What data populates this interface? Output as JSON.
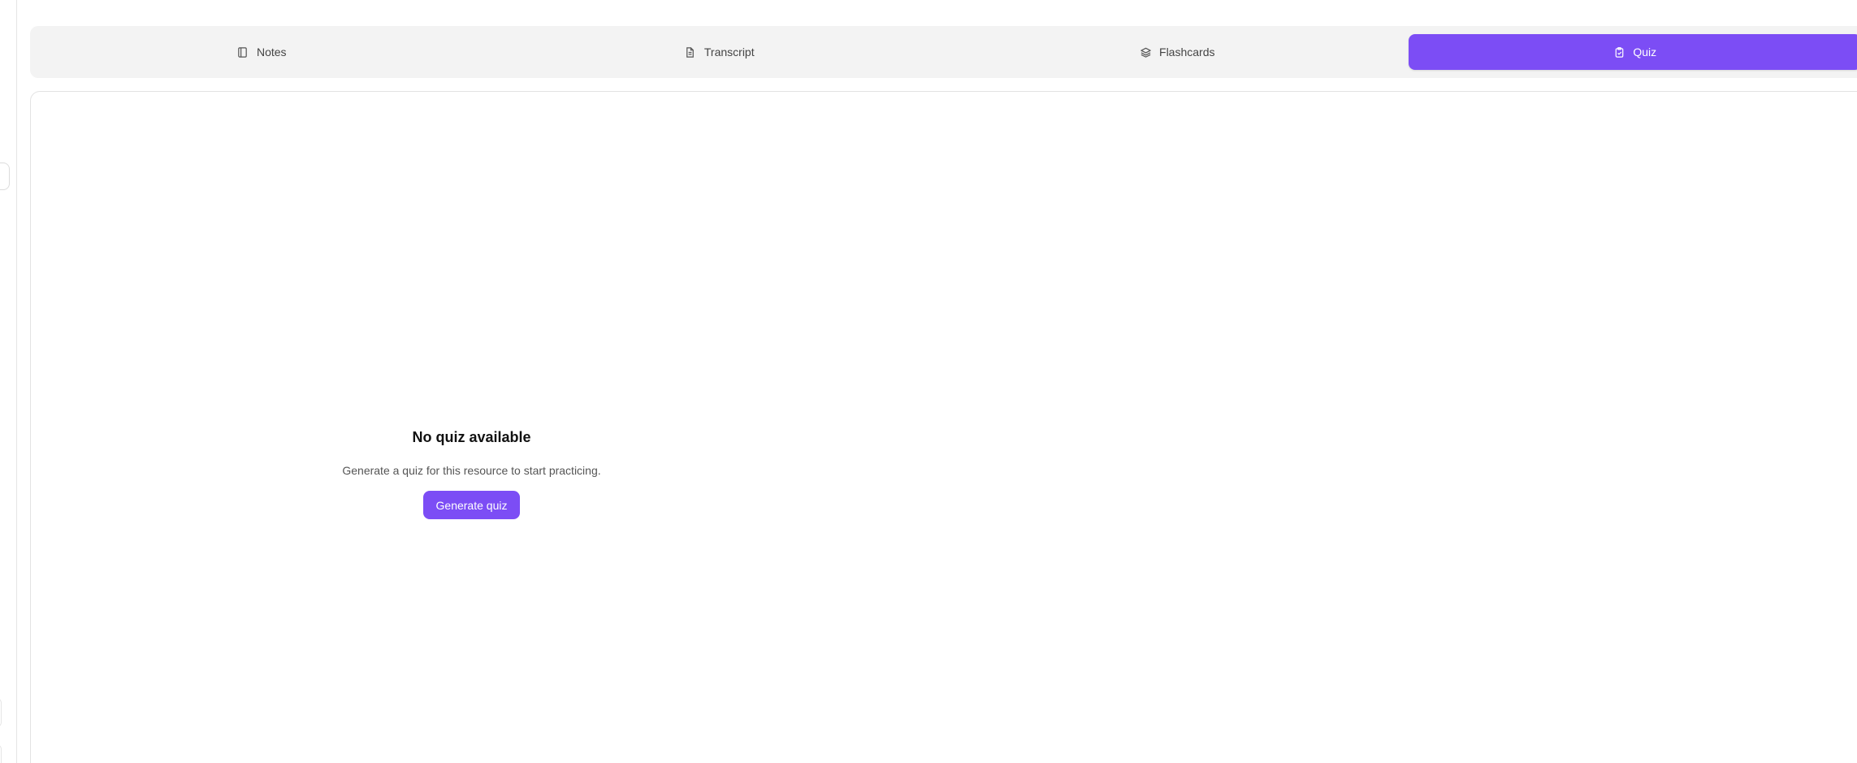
{
  "tabs": [
    {
      "label": "Notes",
      "icon": "notebook-icon",
      "active": false
    },
    {
      "label": "Transcript",
      "icon": "file-text-icon",
      "active": false
    },
    {
      "label": "Flashcards",
      "icon": "layers-icon",
      "active": false
    },
    {
      "label": "Quiz",
      "icon": "clipboard-check-icon",
      "active": true
    }
  ],
  "empty_state": {
    "title": "No quiz available",
    "description": "Generate a quiz for this resource to start practicing.",
    "button_label": "Generate quiz"
  },
  "colors": {
    "accent": "#7c4df5",
    "tabbar_bg": "#f3f3f3",
    "border": "#e3e3e3"
  }
}
